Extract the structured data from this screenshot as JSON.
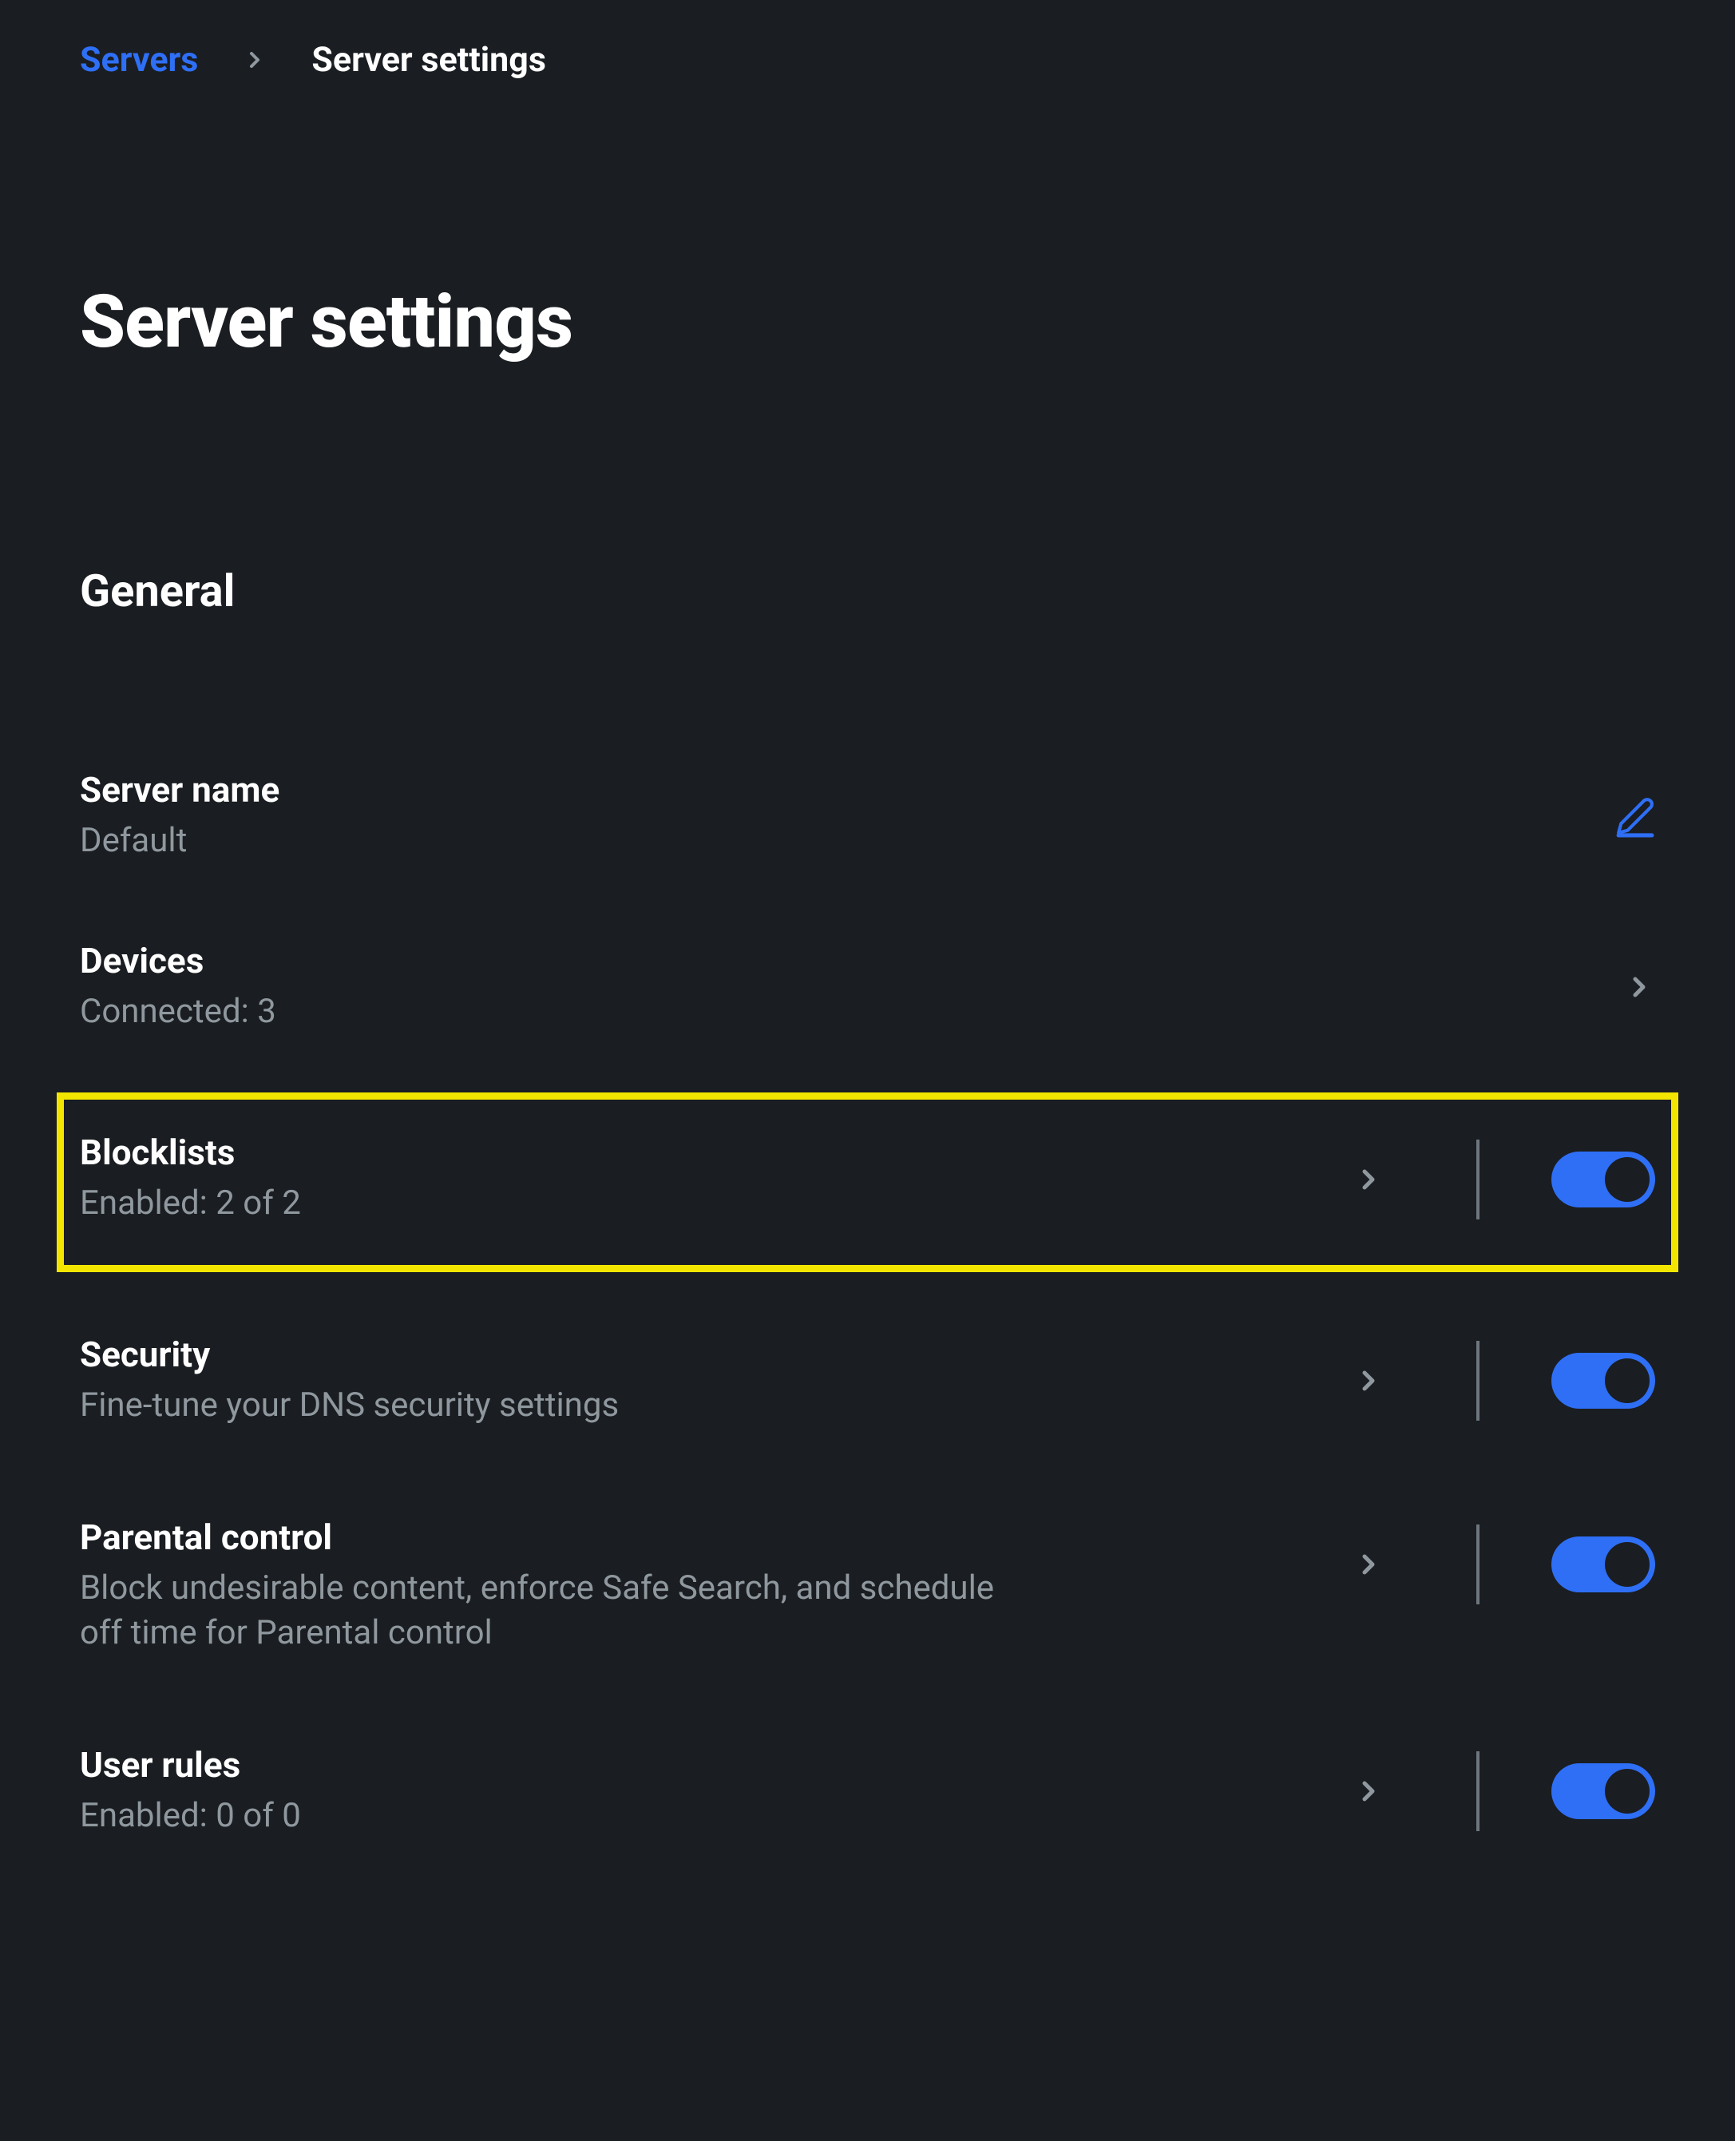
{
  "breadcrumb": {
    "root": "Servers",
    "current": "Server settings"
  },
  "page_title": "Server settings",
  "section_title": "General",
  "rows": {
    "server_name": {
      "label": "Server name",
      "value": "Default"
    },
    "devices": {
      "label": "Devices",
      "value": "Connected: 3"
    },
    "blocklists": {
      "label": "Blocklists",
      "value": "Enabled: 2 of 2",
      "toggle_on": true
    },
    "security": {
      "label": "Security",
      "value": "Fine-tune your DNS security settings",
      "toggle_on": true
    },
    "parental": {
      "label": "Parental control",
      "value": "Block undesirable content, enforce Safe Search, and schedule off time for Parental control",
      "toggle_on": true
    },
    "user_rules": {
      "label": "User rules",
      "value": "Enabled: 0 of 0",
      "toggle_on": true
    }
  }
}
